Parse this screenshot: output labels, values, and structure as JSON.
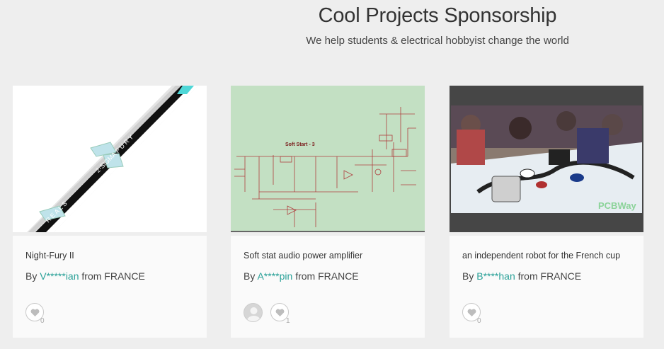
{
  "header": {
    "title": "Cool Projects Sponsorship",
    "subtitle": "We help students & electrical hobbyist change the world"
  },
  "projects": [
    {
      "name": "Night-Fury II",
      "by": "By",
      "author": "V*****ian",
      "from": "from FRANCE",
      "likes": "0",
      "image": "rocket-photo"
    },
    {
      "name": "Soft stat audio power amplifier",
      "by": "By",
      "author": "A****pin",
      "from": "from FRANCE",
      "likes": "1",
      "image": "schematic-diagram",
      "schematic_label": "Soft Start - 3"
    },
    {
      "name": "an independent robot for the French cup",
      "by": "By",
      "author": "B****han",
      "from": "from FRANCE",
      "likes": "0",
      "image": "robot-competition-photo",
      "watermark": "PCBWay"
    }
  ],
  "colors": {
    "accent": "#2aa198",
    "background": "#eeeeee"
  }
}
